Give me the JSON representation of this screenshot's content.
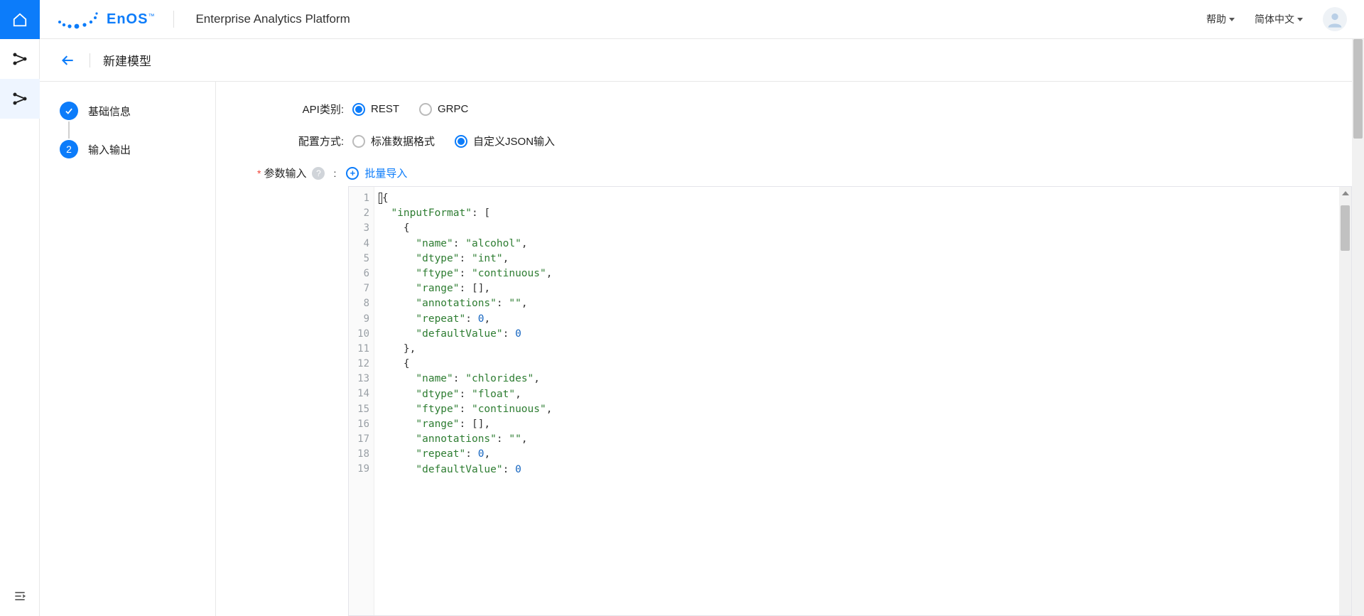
{
  "header": {
    "product_title": "Enterprise Analytics Platform",
    "help_label": "帮助",
    "lang_label": "简体中文",
    "brand_wordmark": "EnOS",
    "brand_tm": "™"
  },
  "subheader": {
    "title": "新建模型"
  },
  "steps": [
    {
      "label": "基础信息",
      "state": "done"
    },
    {
      "label": "输入输出",
      "state": "current",
      "number": "2"
    }
  ],
  "form": {
    "api_category_label": "API类别:",
    "api_options": [
      {
        "value": "REST",
        "checked": true
      },
      {
        "value": "GRPC",
        "checked": false
      }
    ],
    "config_mode_label": "配置方式:",
    "config_options": [
      {
        "value": "标准数据格式",
        "checked": false
      },
      {
        "value": "自定义JSON输入",
        "checked": true
      }
    ],
    "param_input_label": "参数输入",
    "colon": ":",
    "help_badge": "?",
    "batch_import_label": "批量导入"
  },
  "editor": {
    "line_count": 19,
    "tokens": [
      [
        {
          "t": "cursor"
        },
        {
          "t": "punc",
          "v": "{"
        }
      ],
      [
        {
          "t": "indent",
          "n": 1
        },
        {
          "t": "key",
          "v": "\"inputFormat\""
        },
        {
          "t": "punc",
          "v": ": ["
        }
      ],
      [
        {
          "t": "indent",
          "n": 2
        },
        {
          "t": "punc",
          "v": "{"
        }
      ],
      [
        {
          "t": "indent",
          "n": 3
        },
        {
          "t": "key",
          "v": "\"name\""
        },
        {
          "t": "punc",
          "v": ": "
        },
        {
          "t": "str",
          "v": "\"alcohol\""
        },
        {
          "t": "punc",
          "v": ","
        }
      ],
      [
        {
          "t": "indent",
          "n": 3
        },
        {
          "t": "key",
          "v": "\"dtype\""
        },
        {
          "t": "punc",
          "v": ": "
        },
        {
          "t": "str",
          "v": "\"int\""
        },
        {
          "t": "punc",
          "v": ","
        }
      ],
      [
        {
          "t": "indent",
          "n": 3
        },
        {
          "t": "key",
          "v": "\"ftype\""
        },
        {
          "t": "punc",
          "v": ": "
        },
        {
          "t": "str",
          "v": "\"continuous\""
        },
        {
          "t": "punc",
          "v": ","
        }
      ],
      [
        {
          "t": "indent",
          "n": 3
        },
        {
          "t": "key",
          "v": "\"range\""
        },
        {
          "t": "punc",
          "v": ": [],"
        }
      ],
      [
        {
          "t": "indent",
          "n": 3
        },
        {
          "t": "key",
          "v": "\"annotations\""
        },
        {
          "t": "punc",
          "v": ": "
        },
        {
          "t": "str",
          "v": "\"\""
        },
        {
          "t": "punc",
          "v": ","
        }
      ],
      [
        {
          "t": "indent",
          "n": 3
        },
        {
          "t": "key",
          "v": "\"repeat\""
        },
        {
          "t": "punc",
          "v": ": "
        },
        {
          "t": "num",
          "v": "0"
        },
        {
          "t": "punc",
          "v": ","
        }
      ],
      [
        {
          "t": "indent",
          "n": 3
        },
        {
          "t": "key",
          "v": "\"defaultValue\""
        },
        {
          "t": "punc",
          "v": ": "
        },
        {
          "t": "num",
          "v": "0"
        }
      ],
      [
        {
          "t": "indent",
          "n": 2
        },
        {
          "t": "punc",
          "v": "},"
        }
      ],
      [
        {
          "t": "indent",
          "n": 2
        },
        {
          "t": "punc",
          "v": "{"
        }
      ],
      [
        {
          "t": "indent",
          "n": 3
        },
        {
          "t": "key",
          "v": "\"name\""
        },
        {
          "t": "punc",
          "v": ": "
        },
        {
          "t": "str",
          "v": "\"chlorides\""
        },
        {
          "t": "punc",
          "v": ","
        }
      ],
      [
        {
          "t": "indent",
          "n": 3
        },
        {
          "t": "key",
          "v": "\"dtype\""
        },
        {
          "t": "punc",
          "v": ": "
        },
        {
          "t": "str",
          "v": "\"float\""
        },
        {
          "t": "punc",
          "v": ","
        }
      ],
      [
        {
          "t": "indent",
          "n": 3
        },
        {
          "t": "key",
          "v": "\"ftype\""
        },
        {
          "t": "punc",
          "v": ": "
        },
        {
          "t": "str",
          "v": "\"continuous\""
        },
        {
          "t": "punc",
          "v": ","
        }
      ],
      [
        {
          "t": "indent",
          "n": 3
        },
        {
          "t": "key",
          "v": "\"range\""
        },
        {
          "t": "punc",
          "v": ": [],"
        }
      ],
      [
        {
          "t": "indent",
          "n": 3
        },
        {
          "t": "key",
          "v": "\"annotations\""
        },
        {
          "t": "punc",
          "v": ": "
        },
        {
          "t": "str",
          "v": "\"\""
        },
        {
          "t": "punc",
          "v": ","
        }
      ],
      [
        {
          "t": "indent",
          "n": 3
        },
        {
          "t": "key",
          "v": "\"repeat\""
        },
        {
          "t": "punc",
          "v": ": "
        },
        {
          "t": "num",
          "v": "0"
        },
        {
          "t": "punc",
          "v": ","
        }
      ],
      [
        {
          "t": "indent",
          "n": 3
        },
        {
          "t": "key",
          "v": "\"defaultValue\""
        },
        {
          "t": "punc",
          "v": ": "
        },
        {
          "t": "num",
          "v": "0"
        }
      ]
    ]
  }
}
